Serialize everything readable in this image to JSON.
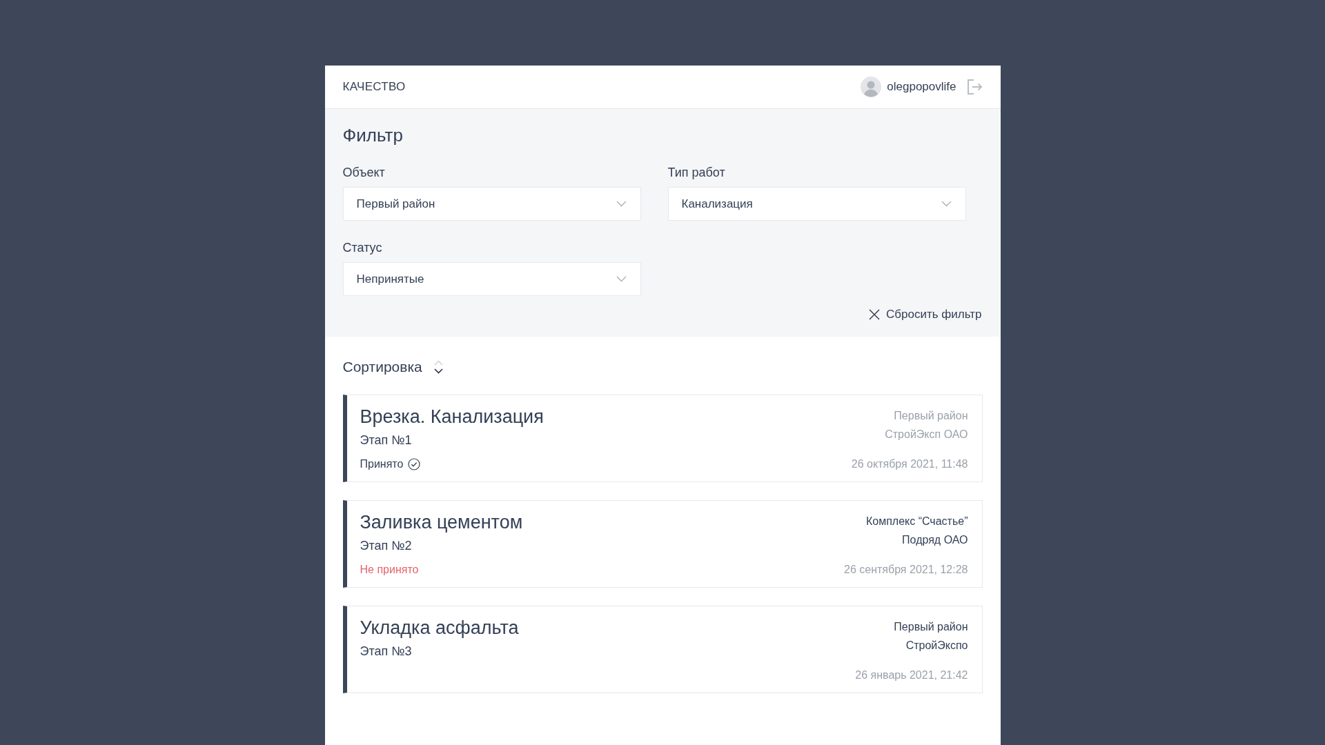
{
  "header": {
    "title": "КАЧЕСТВО",
    "user": {
      "name": "olegpopovlife"
    }
  },
  "filter": {
    "title": "Фильтр",
    "fields": [
      {
        "label": "Объект",
        "value": "Первый район"
      },
      {
        "label": "Тип работ",
        "value": "Канализация"
      },
      {
        "label": "Статус",
        "value": "Непринятые"
      }
    ],
    "reset_button": "Сбросить фильтр"
  },
  "sort": {
    "label": "Сортировка",
    "descending": true
  },
  "cards": [
    {
      "title": "Врезка. Канализация",
      "stage": "Этап №1",
      "status": {
        "kind": "accepted",
        "text": "Принято"
      },
      "location": "Первый район",
      "contractor": "СтройЭксп ОАО",
      "date": "26 октября 2021, 11:48",
      "dimmed": true
    },
    {
      "title": "Заливка цементом",
      "stage": "Этап №2",
      "status": {
        "kind": "rejected",
        "text": "Не принято"
      },
      "location": "Комплекс “Счастье”",
      "contractor": "Подряд ОАО",
      "date": "26 сентября 2021, 12:28",
      "dimmed": false
    },
    {
      "title": "Укладка асфальта",
      "stage": "Этап №3",
      "location": "Первый район",
      "contractor": "СтройЭкспо",
      "date": "26 январь 2021, 21:42",
      "dimmed": false
    }
  ]
}
